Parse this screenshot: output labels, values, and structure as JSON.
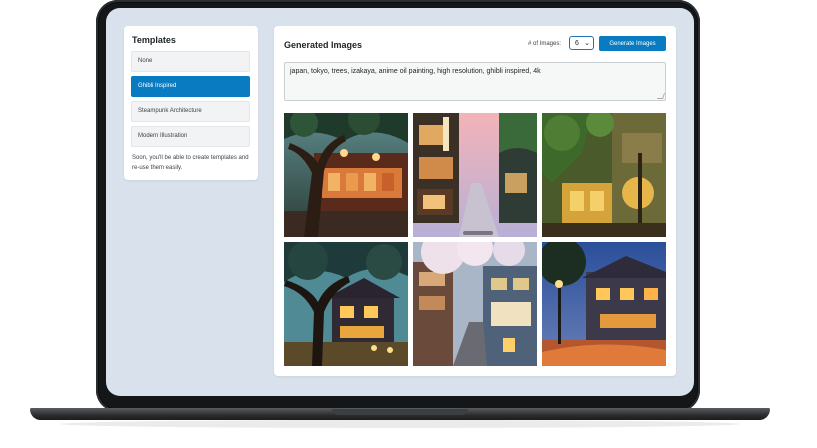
{
  "templates": {
    "title": "Templates",
    "items": [
      {
        "label": "None",
        "active": false
      },
      {
        "label": "Ghibli Inspired",
        "active": true
      },
      {
        "label": "Steampunk Architecture",
        "active": false
      },
      {
        "label": "Modern Illustration",
        "active": false
      }
    ],
    "note": "Soon, you'll be able to create templates and re-use them easily."
  },
  "main": {
    "title": "Generated Images",
    "count_label": "# of Images:",
    "count_value": "6",
    "generate_label": "Generate Images",
    "prompt": "japan, tokyo, trees, izakaya, anime oil painting, high resolution, ghibli inspired, 4k"
  },
  "images": [
    {
      "name": "izakaya-under-tree",
      "icon": "generated-image"
    },
    {
      "name": "tokyo-alley-dusk",
      "icon": "generated-image"
    },
    {
      "name": "ivy-covered-street",
      "icon": "generated-image"
    },
    {
      "name": "house-under-tree-night",
      "icon": "generated-image"
    },
    {
      "name": "cherry-blossom-street",
      "icon": "generated-image"
    },
    {
      "name": "street-at-night",
      "icon": "generated-image"
    }
  ],
  "colors": {
    "accent": "#087bc1",
    "screen_bg": "#d9e2ec",
    "laptop_frame": "#141618"
  }
}
